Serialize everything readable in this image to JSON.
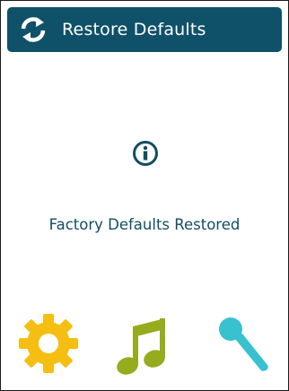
{
  "header": {
    "icon": "refresh-icon",
    "title": "Restore Defaults"
  },
  "status": {
    "icon": "info-icon",
    "message": "Factory Defaults Restored"
  },
  "dock": {
    "items": [
      {
        "icon": "gear-icon",
        "color": "#f5be12"
      },
      {
        "icon": "music-note-icon",
        "color": "#97ab1e"
      },
      {
        "icon": "microphone-icon",
        "color": "#38c1cf"
      }
    ]
  },
  "colors": {
    "header_bg": "#0f5169",
    "text": "#124d63",
    "background": "#ffffff"
  }
}
